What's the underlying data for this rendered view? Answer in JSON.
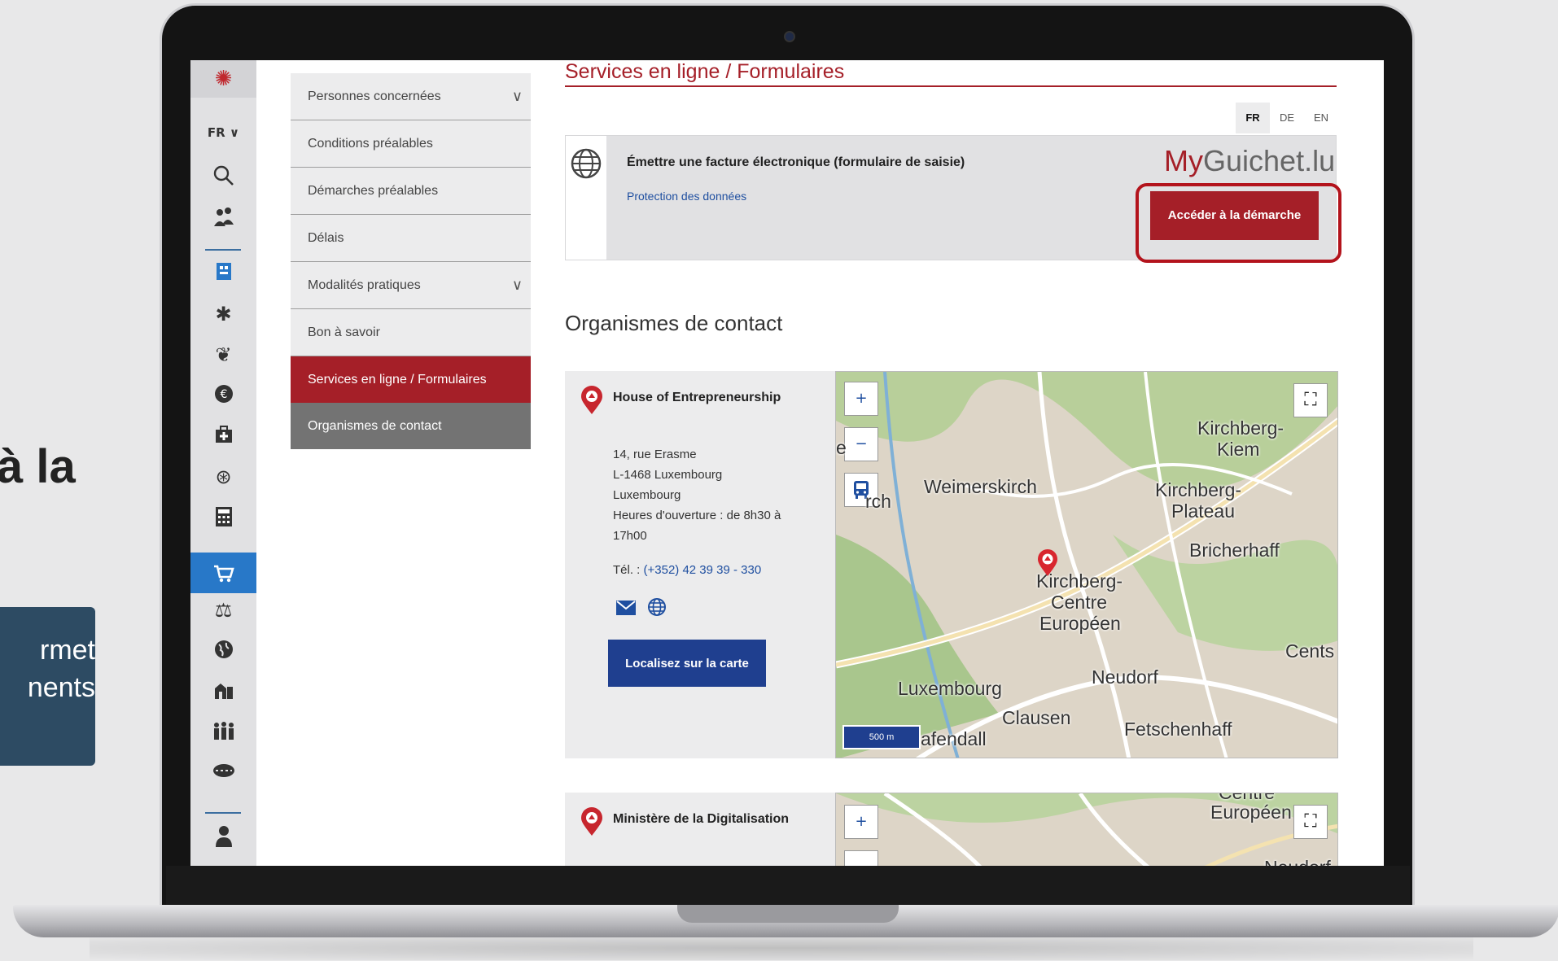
{
  "background": {
    "heading_fragment": "à la",
    "box_lines": [
      "rmet",
      "nents"
    ]
  },
  "sidebar": {
    "logo_icon": "luxembourg-logo-icon",
    "lang": "FR ∨",
    "icons": [
      "search-icon",
      "people-icon",
      "building-icon",
      "puzzle-icon",
      "leaf-icon",
      "euro-icon",
      "medical-kit-icon",
      "handshake-icon",
      "calculator-icon",
      "cart-icon",
      "scales-icon",
      "globe-icon",
      "buildings-icon",
      "group-icon",
      "road-icon",
      "user-icon"
    ]
  },
  "menu": {
    "items": [
      {
        "label": "Personnes concernées",
        "chevron": "∨"
      },
      {
        "label": "Conditions préalables",
        "chevron": ""
      },
      {
        "label": "Démarches préalables",
        "chevron": ""
      },
      {
        "label": "Délais",
        "chevron": ""
      },
      {
        "label": "Modalités pratiques",
        "chevron": "∨"
      },
      {
        "label": "Bon à savoir",
        "chevron": ""
      },
      {
        "label": "Services en ligne / Formulaires",
        "chevron": ""
      },
      {
        "label": "Organismes de contact",
        "chevron": ""
      }
    ],
    "active_index": 6
  },
  "page": {
    "title": "Services en ligne / Formulaires",
    "languages": [
      "FR",
      "DE",
      "EN"
    ],
    "selected_language": "FR"
  },
  "form": {
    "title": "Émettre une facture électronique (formulaire de saisie)",
    "link": "Protection des données",
    "brand_prefix": "My",
    "brand_rest": "Guichet.lu",
    "button": "Accéder à la démarche"
  },
  "contacts": {
    "heading": "Organismes de contact",
    "orgs": [
      {
        "name": "House of Entrepreneurship",
        "address": [
          "14, rue Erasme",
          "L-1468 Luxembourg",
          "Luxembourg",
          "Heures d'ouverture :  de 8h30 à",
          "17h00"
        ],
        "tel_label": "Tél. : ",
        "tel": "(+352) 42 39 39 - 330",
        "button": "Localisez sur la carte"
      },
      {
        "name": "Ministère de la Digitalisation"
      }
    ]
  },
  "map": {
    "zoom_in": "+",
    "zoom_out": "−",
    "fullscreen": "⛶",
    "scale": "500 m",
    "labels": [
      "Weimerskirch",
      "Kirchberg-",
      "Kiem",
      "Kirchberg-",
      "Plateau",
      "Bricherhaff",
      "Kirchberg-",
      "Centre",
      "Européen",
      "Cents",
      "Neudorf",
      "Luxembourg",
      "Clausen",
      "afendall",
      "Fetschenhaff",
      "e",
      "rch"
    ],
    "map2_labels": [
      "Centre",
      "Européen",
      "Neudorf"
    ]
  }
}
